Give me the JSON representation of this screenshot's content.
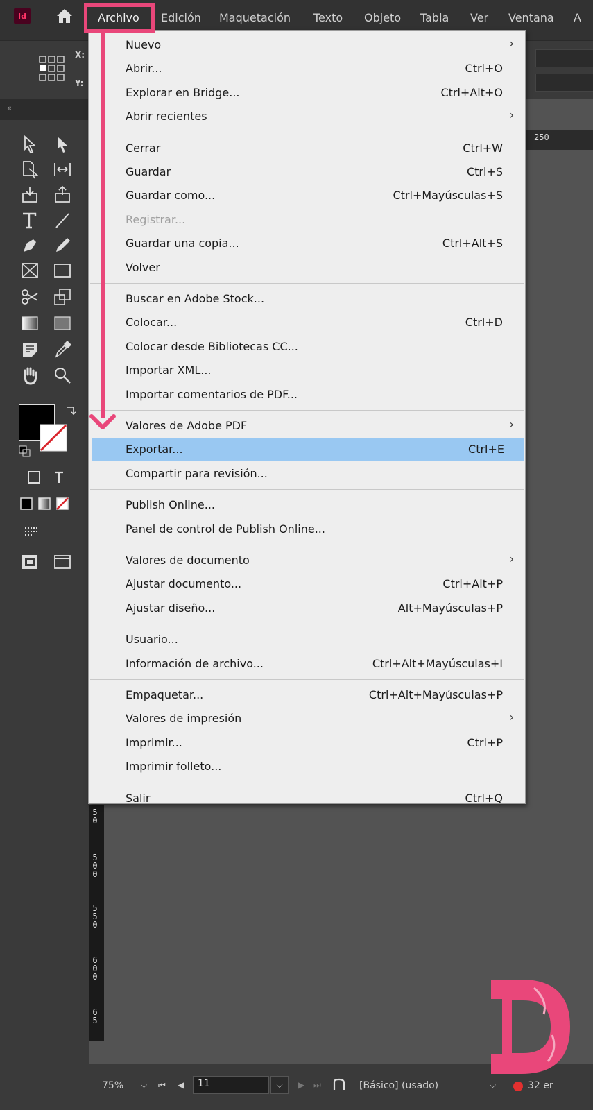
{
  "menubar": {
    "app_badge": "Id",
    "items": [
      "Archivo",
      "Edición",
      "Maquetación",
      "Texto",
      "Objeto",
      "Tabla",
      "Ver",
      "Ventana",
      "A"
    ]
  },
  "controlbar": {
    "x_label": "X:",
    "y_label": "Y:"
  },
  "tools_panel": {
    "collapse_label": "«"
  },
  "ruler": {
    "top_value": "250",
    "left_values": [
      "5 0",
      "5 0 0",
      "5 5 0",
      "6 0 0",
      "6 5"
    ]
  },
  "archivo_menu": {
    "groups": [
      [
        {
          "label": "Nuevo",
          "shortcut": "",
          "submenu": true,
          "disabled": false
        },
        {
          "label": "Abrir...",
          "shortcut": "Ctrl+O",
          "submenu": false,
          "disabled": false
        },
        {
          "label": "Explorar en Bridge...",
          "shortcut": "Ctrl+Alt+O",
          "submenu": false,
          "disabled": false
        },
        {
          "label": "Abrir recientes",
          "shortcut": "",
          "submenu": true,
          "disabled": false
        }
      ],
      [
        {
          "label": "Cerrar",
          "shortcut": "Ctrl+W",
          "submenu": false,
          "disabled": false
        },
        {
          "label": "Guardar",
          "shortcut": "Ctrl+S",
          "submenu": false,
          "disabled": false
        },
        {
          "label": "Guardar como...",
          "shortcut": "Ctrl+Mayúsculas+S",
          "submenu": false,
          "disabled": false
        },
        {
          "label": "Registrar...",
          "shortcut": "",
          "submenu": false,
          "disabled": true
        },
        {
          "label": "Guardar una copia...",
          "shortcut": "Ctrl+Alt+S",
          "submenu": false,
          "disabled": false
        },
        {
          "label": "Volver",
          "shortcut": "",
          "submenu": false,
          "disabled": false
        }
      ],
      [
        {
          "label": "Buscar en Adobe Stock...",
          "shortcut": "",
          "submenu": false,
          "disabled": false
        },
        {
          "label": "Colocar...",
          "shortcut": "Ctrl+D",
          "submenu": false,
          "disabled": false
        },
        {
          "label": "Colocar desde Bibliotecas CC...",
          "shortcut": "",
          "submenu": false,
          "disabled": false
        },
        {
          "label": "Importar XML...",
          "shortcut": "",
          "submenu": false,
          "disabled": false
        },
        {
          "label": "Importar comentarios de PDF...",
          "shortcut": "",
          "submenu": false,
          "disabled": false
        }
      ],
      [
        {
          "label": "Valores de Adobe PDF",
          "shortcut": "",
          "submenu": true,
          "disabled": false
        },
        {
          "label": "Exportar...",
          "shortcut": "Ctrl+E",
          "submenu": false,
          "disabled": false,
          "highlighted": true
        },
        {
          "label": "Compartir para revisión...",
          "shortcut": "",
          "submenu": false,
          "disabled": false
        }
      ],
      [
        {
          "label": "Publish Online...",
          "shortcut": "",
          "submenu": false,
          "disabled": false
        },
        {
          "label": "Panel de control de Publish Online...",
          "shortcut": "",
          "submenu": false,
          "disabled": false
        }
      ],
      [
        {
          "label": "Valores de documento",
          "shortcut": "",
          "submenu": true,
          "disabled": false
        },
        {
          "label": "Ajustar documento...",
          "shortcut": "Ctrl+Alt+P",
          "submenu": false,
          "disabled": false
        },
        {
          "label": "Ajustar diseño...",
          "shortcut": "Alt+Mayúsculas+P",
          "submenu": false,
          "disabled": false
        }
      ],
      [
        {
          "label": "Usuario...",
          "shortcut": "",
          "submenu": false,
          "disabled": false
        },
        {
          "label": "Información de archivo...",
          "shortcut": "Ctrl+Alt+Mayúsculas+I",
          "submenu": false,
          "disabled": false
        }
      ],
      [
        {
          "label": "Empaquetar...",
          "shortcut": "Ctrl+Alt+Mayúsculas+P",
          "submenu": false,
          "disabled": false
        },
        {
          "label": "Valores de impresión",
          "shortcut": "",
          "submenu": true,
          "disabled": false
        },
        {
          "label": "Imprimir...",
          "shortcut": "Ctrl+P",
          "submenu": false,
          "disabled": false
        },
        {
          "label": "Imprimir folleto...",
          "shortcut": "",
          "submenu": false,
          "disabled": false
        }
      ],
      [
        {
          "label": "Salir",
          "shortcut": "Ctrl+Q",
          "submenu": false,
          "disabled": false
        }
      ]
    ]
  },
  "statusbar": {
    "zoom": "75%",
    "page": "11",
    "style": "[Básico] (usado)",
    "errors": "32 er"
  },
  "colors": {
    "accent_pink": "#e9477a",
    "highlight_blue": "#99c8f2",
    "menu_bg": "#eeeeee",
    "ui_dark": "#323232"
  }
}
